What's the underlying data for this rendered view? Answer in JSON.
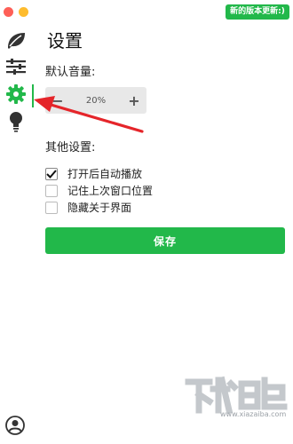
{
  "window": {
    "update_badge": "新的版本更新:)"
  },
  "sidebar": {
    "items": [
      {
        "icon": "leaf-icon"
      },
      {
        "icon": "sliders-icon"
      },
      {
        "icon": "gear-icon",
        "active": true
      },
      {
        "icon": "lightbulb-icon"
      }
    ],
    "footer_icon": "account-icon"
  },
  "page": {
    "title": "设置"
  },
  "volume": {
    "label": "默认音量:",
    "decrement": "−",
    "value": "20%",
    "increment": "+"
  },
  "other": {
    "label": "其他设置:",
    "options": [
      {
        "label": "打开后自动播放",
        "checked": true
      },
      {
        "label": "记住上次窗口位置",
        "checked": false
      },
      {
        "label": "隐藏关于界面",
        "checked": false
      }
    ]
  },
  "actions": {
    "save_label": "保存"
  },
  "watermark": {
    "site": "www.xiazaiba.com"
  },
  "colors": {
    "accent": "#22b84a",
    "annotation": "#e5252a",
    "stepper_bg": "#e8e8e8"
  }
}
